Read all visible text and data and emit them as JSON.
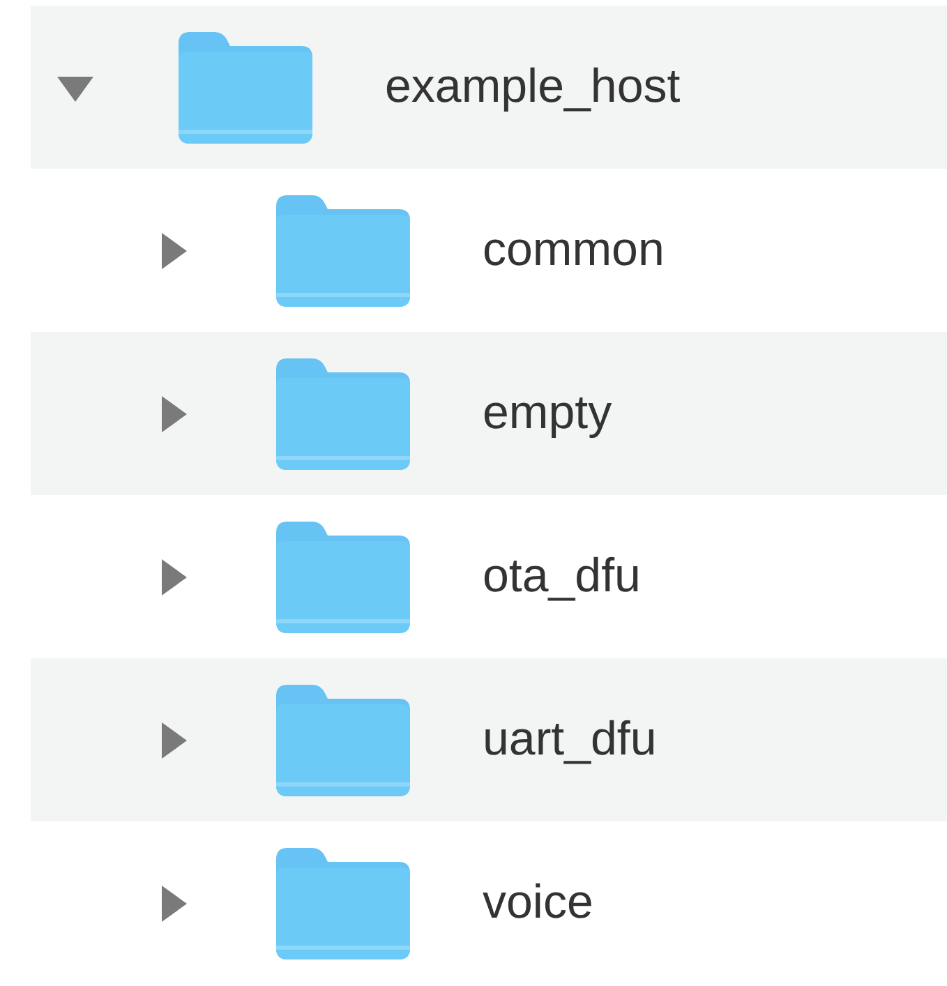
{
  "tree": [
    {
      "name": "example_host",
      "expanded": true,
      "children": [
        {
          "name": "common",
          "expanded": false
        },
        {
          "name": "empty",
          "expanded": false
        },
        {
          "name": "ota_dfu",
          "expanded": false
        },
        {
          "name": "uart_dfu",
          "expanded": false
        },
        {
          "name": "voice",
          "expanded": false
        }
      ]
    }
  ]
}
